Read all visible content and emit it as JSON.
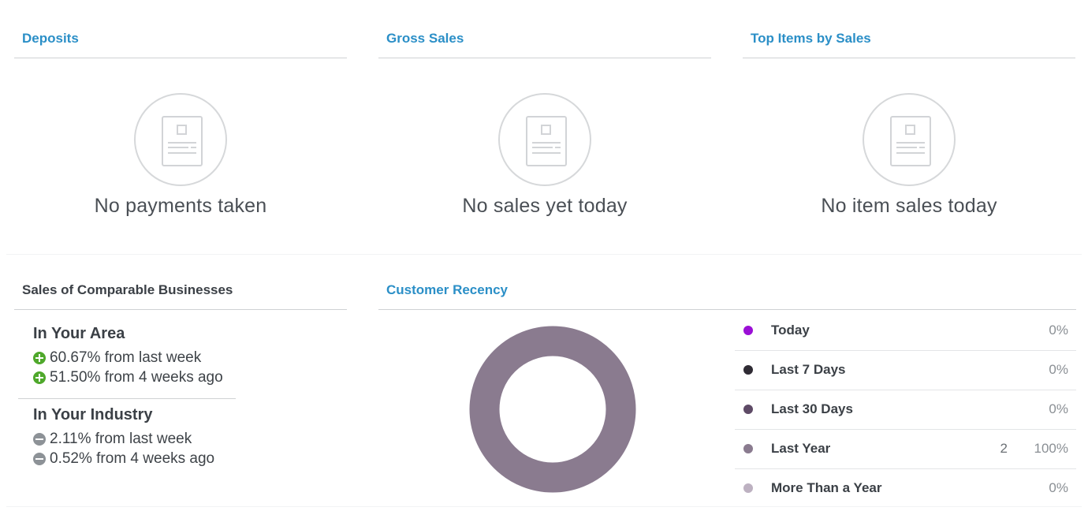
{
  "deposits": {
    "title": "Deposits",
    "empty_message": "No payments taken"
  },
  "gross_sales": {
    "title": "Gross Sales",
    "empty_message": "No sales yet today"
  },
  "top_items": {
    "title": "Top Items by Sales",
    "empty_message": "No item sales today"
  },
  "comparable": {
    "title": "Sales of Comparable Businesses",
    "area": {
      "heading": "In Your Area",
      "lines": [
        {
          "text": "60.67% from last week",
          "trend": "up"
        },
        {
          "text": "51.50% from 4 weeks ago",
          "trend": "up"
        }
      ]
    },
    "industry": {
      "heading": "In Your Industry",
      "lines": [
        {
          "text": "2.11% from last week",
          "trend": "down"
        },
        {
          "text": "0.52% from 4 weeks ago",
          "trend": "down"
        }
      ]
    }
  },
  "recency": {
    "title": "Customer Recency",
    "rows": [
      {
        "label": "Today",
        "count": "",
        "pct": "0%",
        "color": "#9b0fd6"
      },
      {
        "label": "Last 7 Days",
        "count": "",
        "pct": "0%",
        "color": "#2f2b34"
      },
      {
        "label": "Last 30 Days",
        "count": "",
        "pct": "0%",
        "color": "#5e4a66"
      },
      {
        "label": "Last Year",
        "count": "2",
        "pct": "100%",
        "color": "#8a7b8f"
      },
      {
        "label": "More Than a Year",
        "count": "",
        "pct": "0%",
        "color": "#bdb1c1"
      }
    ],
    "donut_color": "#8a7b8f"
  },
  "colors": {
    "accent": "#2b8fc7",
    "positive": "#4fa82b",
    "neutral": "#8d9297"
  },
  "icons": {
    "empty_state": "receipt-icon",
    "increase": "plus-circle-icon",
    "decrease": "minus-circle-icon"
  }
}
